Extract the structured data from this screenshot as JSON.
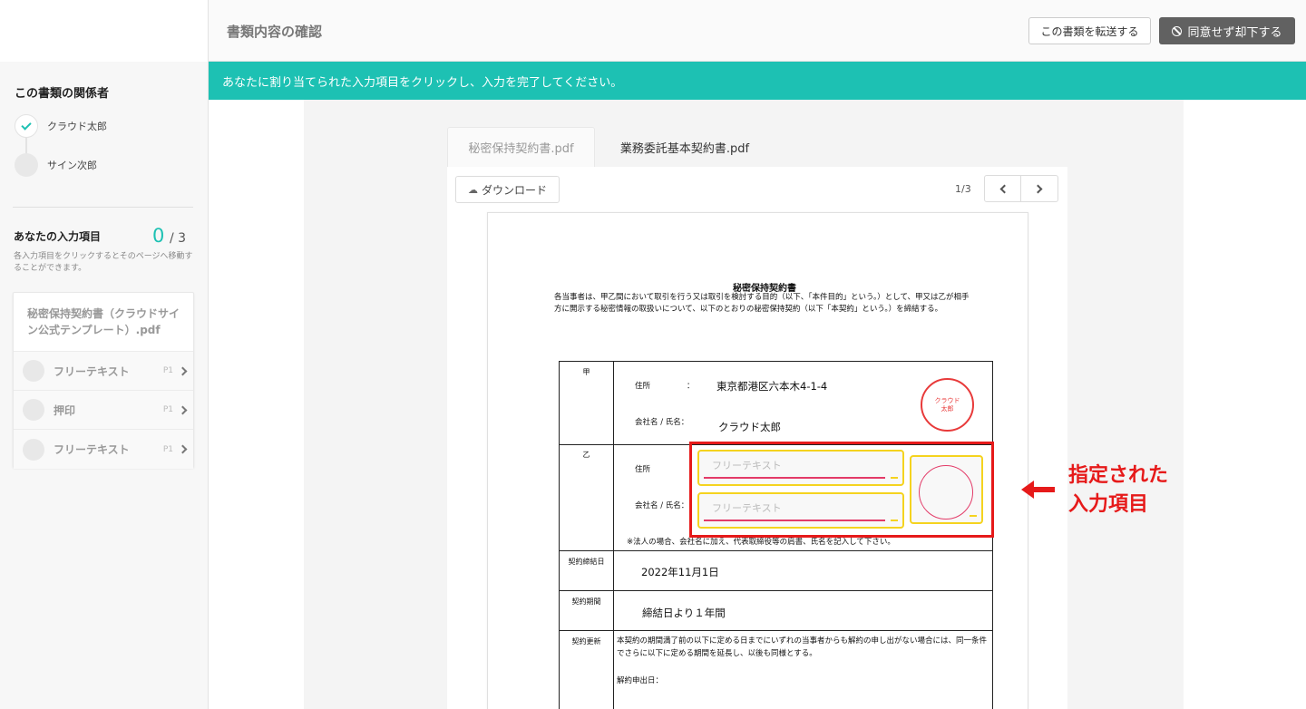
{
  "header": {
    "title": "書類内容の確認",
    "forward_label": "この書類を転送する",
    "decline_label": "同意せず却下する",
    "decline_icon": "ban-icon"
  },
  "sidebar": {
    "parties_title": "この書類の関係者",
    "parties": [
      {
        "name": "クラウド太郎",
        "status": "done"
      },
      {
        "name": "サイン次郎",
        "status": "pending"
      }
    ],
    "inputs_title": "あなたの入力項目",
    "inputs_done": "0",
    "inputs_total": "/ 3",
    "inputs_hint": "各入力項目をクリックするとそのページへ移動することができます。",
    "file_name": "秘密保持契約書（クラウドサイン公式テンプレート）.pdf",
    "items": [
      {
        "label": "フリーテキスト",
        "page": "P1"
      },
      {
        "label": "押印",
        "page": "P1"
      },
      {
        "label": "フリーテキスト",
        "page": "P1"
      }
    ]
  },
  "banner": {
    "text": "あなたに割り当てられた入力項目をクリックし、入力を完了してください。"
  },
  "viewer": {
    "tabs": [
      {
        "label": "秘密保持契約書.pdf",
        "active": true
      },
      {
        "label": "業務委託基本契約書.pdf",
        "active": false
      }
    ],
    "download_label": "ダウンロード",
    "page_indicator": "1/3"
  },
  "document": {
    "title": "秘密保持契約書",
    "intro": "各当事者は、甲乙間において取引を行う又は取引を検討する目的（以下、「本件目的」という。）として、甲又は乙が相手方に開示する秘密情報の取扱いについて、以下のとおりの秘密保持契約（以下「本契約」という。）を締結する。",
    "party_a_label": "甲",
    "party_b_label": "乙",
    "address_label": "住所",
    "colon": "：",
    "company_label": "会社名 / 氏名：",
    "party_a_address": "東京都港区六本木4-1-4",
    "party_a_name": "クラウド太郎",
    "stamp_text": "クラウド\n太郎",
    "placeholder": "フリーテキスト",
    "note": "※法人の場合、会社名に加え、代表取締役等の肩書、氏名を記入して下さい。",
    "contract_date_label": "契約締結日",
    "contract_date": "2022年11月1日",
    "contract_period_label": "契約期間",
    "contract_period": "締結日より１年間",
    "renewal_label": "契約更新",
    "renewal_text": "本契約の期間満了前の以下に定める日までにいずれの当事者からも解約の申し出がない場合には、同一条件でさらに以下に定める期間を延長し、以後も同様とする。",
    "renewal_date_label": "解約申出日："
  },
  "callout": {
    "line1": "指定された",
    "line2": "入力項目"
  },
  "colors": {
    "accent": "#1dc1b3",
    "field_border": "#f5d31f",
    "field_underline": "#e33b68",
    "highlight": "#e61a1a",
    "stamp": "#e83a3a"
  }
}
